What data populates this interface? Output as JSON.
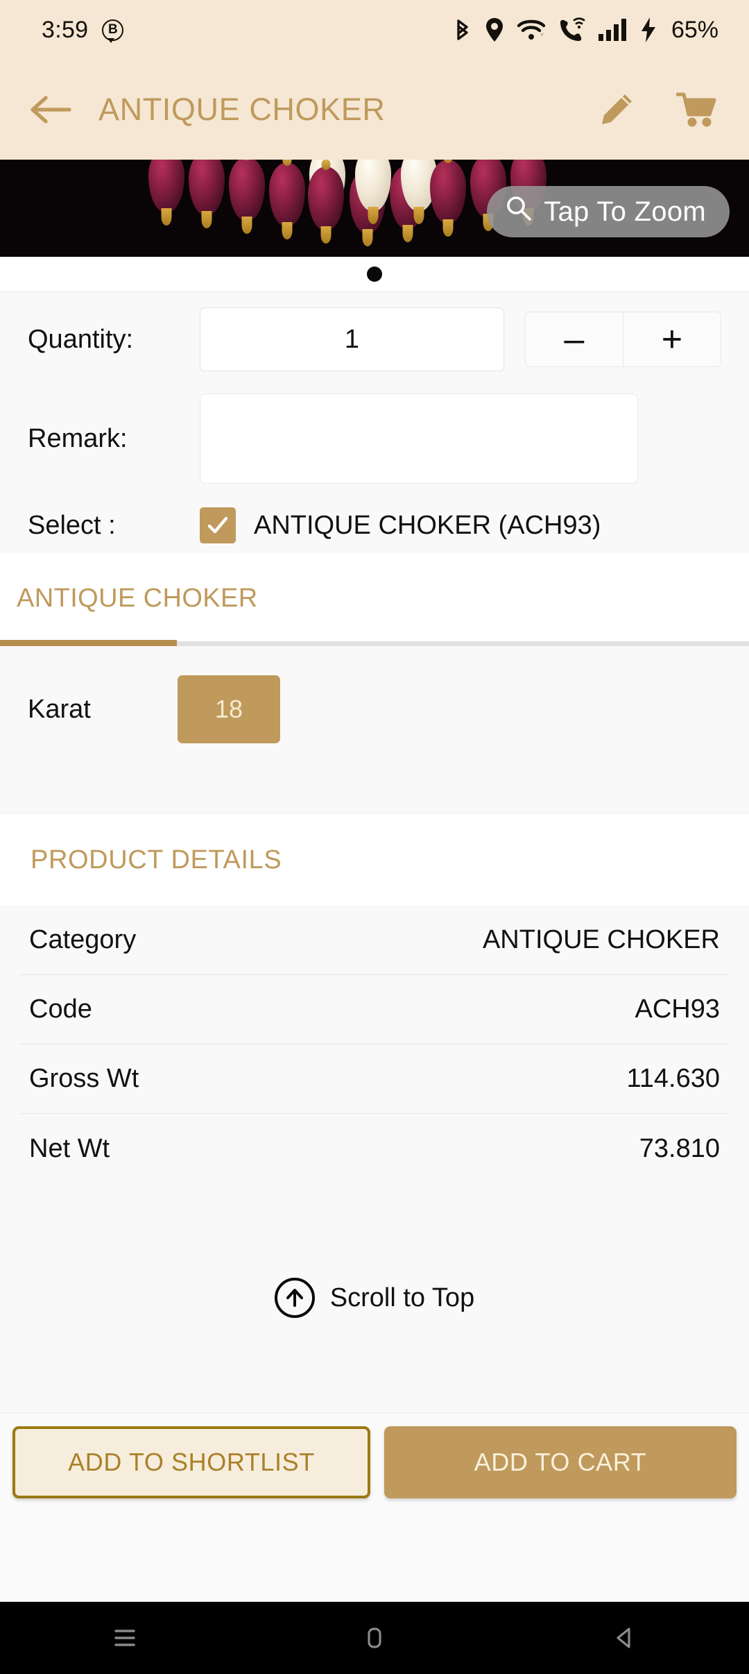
{
  "status_bar": {
    "time": "3:59",
    "badge_letter": "B",
    "battery": "65%",
    "icons": [
      "bluetooth-icon",
      "location-icon",
      "wifi-icon",
      "wifi-calling-icon",
      "signal-bars-icon",
      "charging-bolt-icon"
    ]
  },
  "app_bar": {
    "back_icon": "back-arrow-icon",
    "title": "ANTIQUE CHOKER",
    "edit_icon": "pencil-edit-icon",
    "cart_icon": "shopping-cart-icon"
  },
  "hero": {
    "zoom_button_label": "Tap To Zoom",
    "zoom_icon": "search-magnifier-icon",
    "page_indicator_count": 1,
    "page_indicator_active": 0
  },
  "form": {
    "quantity_label": "Quantity:",
    "quantity_value": "1",
    "decrement_label": "–",
    "increment_label": "+",
    "remark_label": "Remark:",
    "remark_value": "",
    "remark_placeholder": "",
    "select_label": "Select :",
    "select_item_text": "ANTIQUE CHOKER  (ACH93)",
    "select_checked": true
  },
  "tabs": [
    {
      "label": "ANTIQUE CHOKER",
      "active": true
    }
  ],
  "karat": {
    "label": "Karat",
    "chips": [
      {
        "value": "18",
        "selected": true
      }
    ]
  },
  "product_details": {
    "heading": "PRODUCT DETAILS",
    "rows": [
      {
        "key": "Category",
        "value": "ANTIQUE CHOKER"
      },
      {
        "key": "Code",
        "value": "ACH93"
      },
      {
        "key": "Gross Wt",
        "value": "114.630"
      },
      {
        "key": "Net Wt",
        "value": "73.810"
      }
    ]
  },
  "scroll_to_top": {
    "label": "Scroll to Top",
    "icon": "arrow-up-circle-icon"
  },
  "bottom_actions": {
    "shortlist_label": "ADD TO SHORTLIST",
    "cart_label": "ADD TO CART"
  },
  "nav_bar": {
    "recents_icon": "recents-icon",
    "home_icon": "home-icon",
    "back_icon": "back-triangle-icon"
  },
  "colors": {
    "brand_gold": "#bf9a5c",
    "brand_cream": "#f5e7d3",
    "shortlist_border": "#9c7a12",
    "page_bg": "#f9f9f9"
  }
}
